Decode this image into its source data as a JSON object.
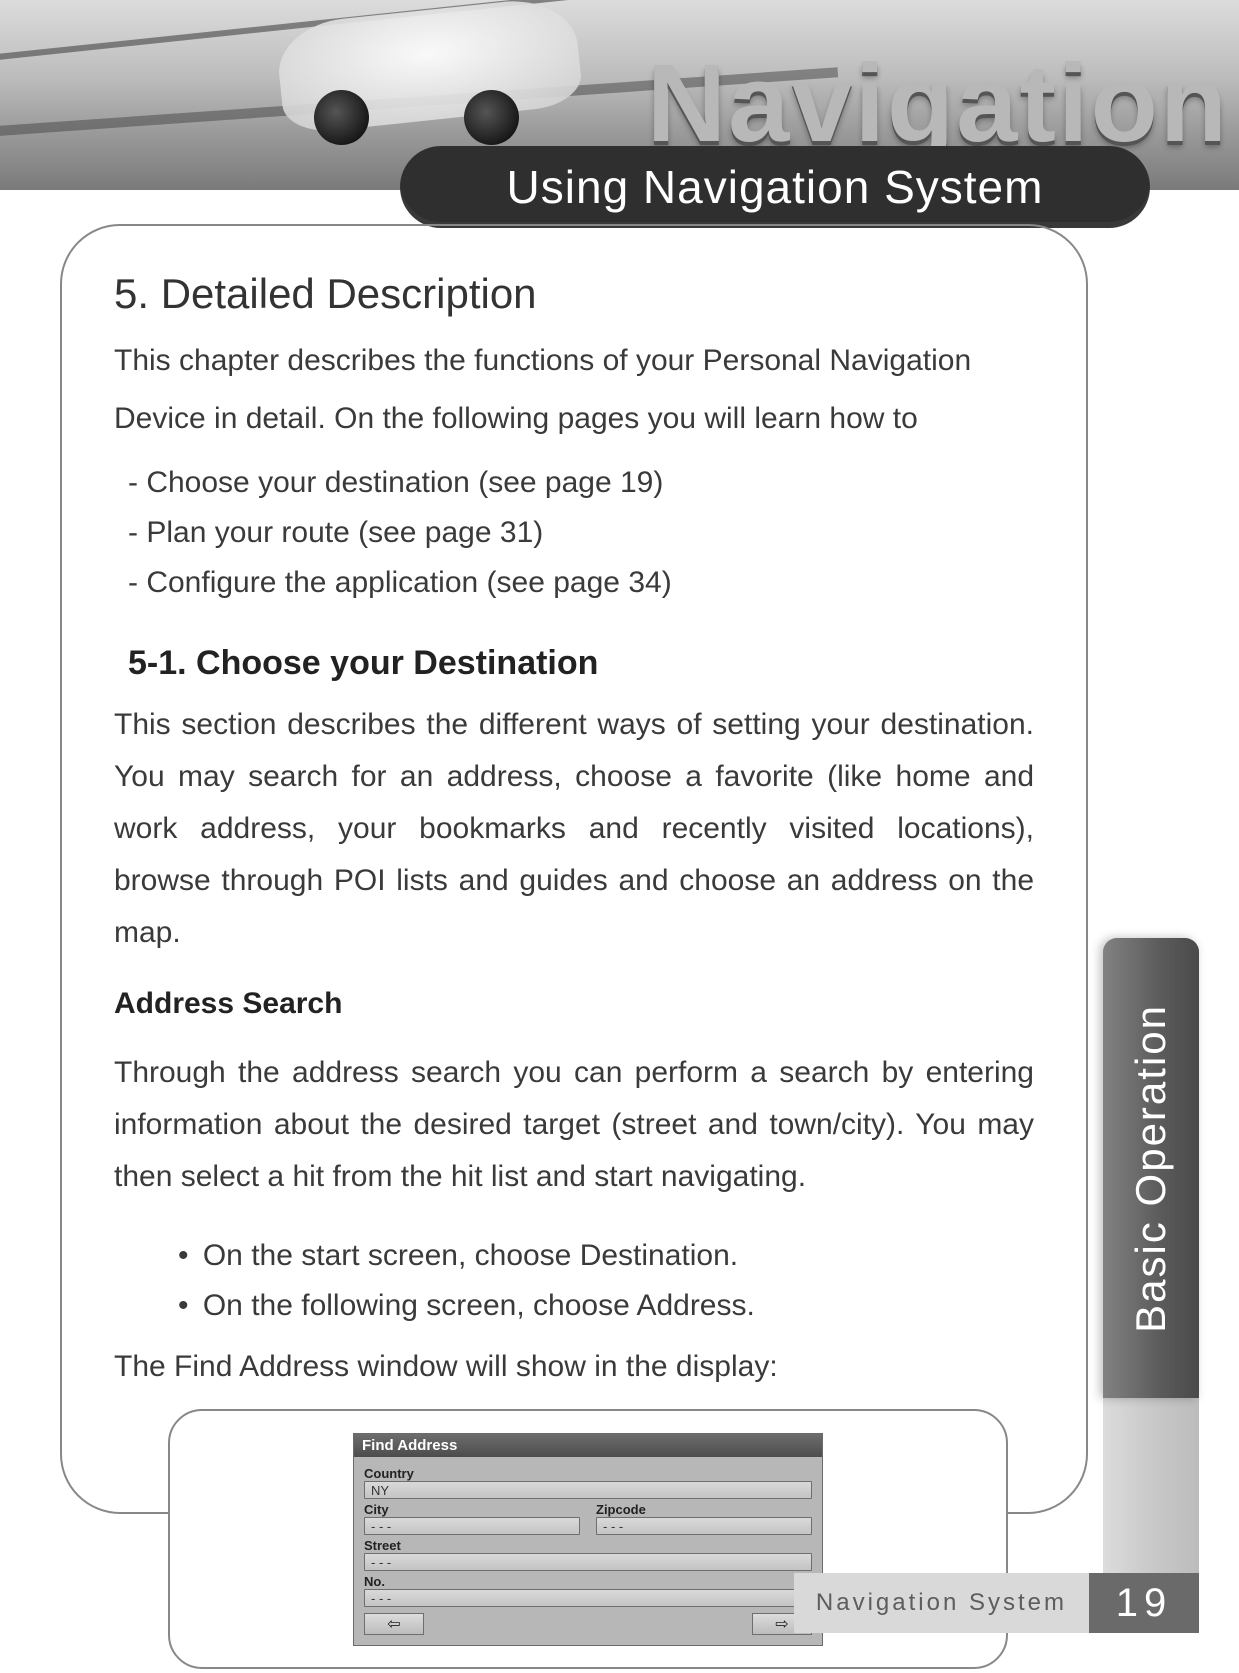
{
  "brand_word": "Navigation",
  "section_pill": "Using Navigation System",
  "side_tab": "Basic Operation",
  "footer": {
    "label": "Navigation System",
    "page": "19"
  },
  "content": {
    "h1": "5. Detailed Description",
    "intro": "This chapter describes the functions of your Personal Navigation Device in detail. On the following pages you will learn how to",
    "dash_items": [
      "Choose your destination (see page 19)",
      "Plan your route (see page 31)",
      "Configure the application (see page 34)"
    ],
    "h2": "5-1. Choose your Destination",
    "para1": "This section describes the different ways of setting your destination. You may search for an address, choose a favorite (like home and work address, your bookmarks and recently visited locations), browse through POI lists and guides and choose an address on the map.",
    "h3": "Address Search",
    "para2": "Through the address search you can perform a search by entering information about the desired target (street and town/city). You may then select a hit from the hit list and start navigating.",
    "bullet_items": [
      "On the start screen, choose Destination.",
      "On the following screen, choose Address."
    ],
    "para3": "The Find Address window will show in the display:"
  },
  "mock": {
    "title": "Find Address",
    "country_label": "Country",
    "country_value": "NY",
    "city_label": "City",
    "city_value": "- - -",
    "zip_label": "Zipcode",
    "zip_value": "- - -",
    "street_label": "Street",
    "street_value": "- - -",
    "no_label": "No.",
    "no_value": "- - -",
    "back_arrow": "⇦",
    "fwd_arrow": "⇨"
  }
}
